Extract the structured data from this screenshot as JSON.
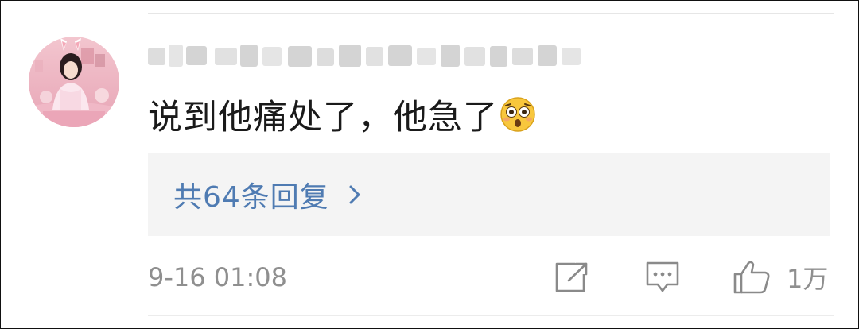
{
  "comment": {
    "username_text": "",
    "text": "说到他痛处了，他急了",
    "emoji": "flushed-face-emoji",
    "reply_link": "共64条回复",
    "timestamp": "9-16 01:08",
    "like_count": "1万"
  },
  "icons": {
    "share": "share-icon",
    "comment": "comment-icon",
    "like": "thumbs-up-icon",
    "chevron": "chevron-right-icon"
  },
  "colors": {
    "background": "#ffffff",
    "text": "#1a1a1a",
    "link": "#4f7bb2",
    "secondary_text": "#8f8f8f",
    "reply_box_bg": "#f4f4f4",
    "icon": "#8a8a8a"
  }
}
